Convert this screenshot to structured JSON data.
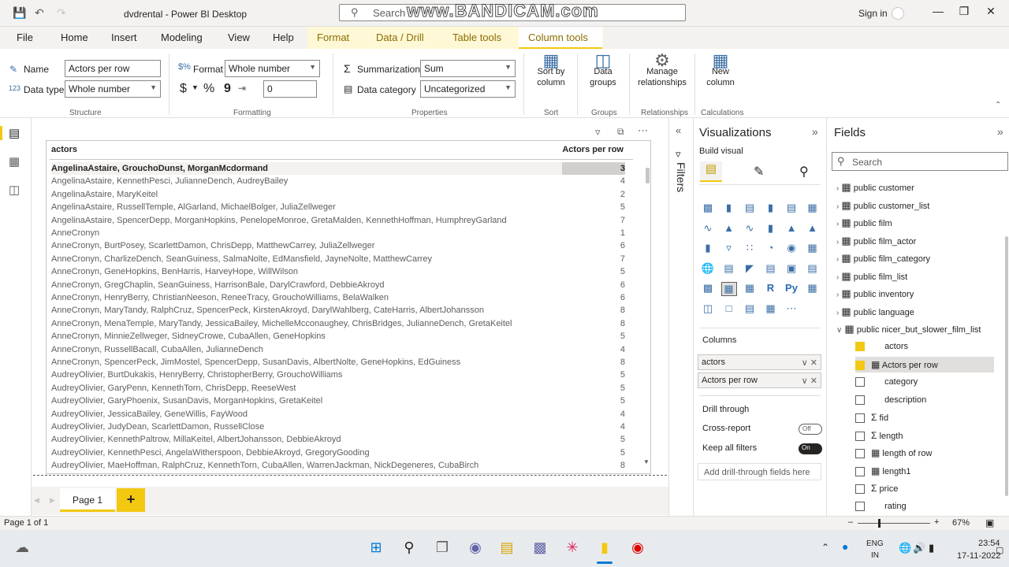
{
  "window": {
    "title": "dvdrental - Power BI Desktop",
    "search_label": "Search",
    "watermark": "www.BANDICAM.com",
    "sign_in": "Sign in"
  },
  "menu": [
    "File",
    "Home",
    "Insert",
    "Modeling",
    "View",
    "Help",
    "Format",
    "Data / Drill",
    "Table tools",
    "Column tools"
  ],
  "ribbon": {
    "name_label": "Name",
    "name_value": "Actors per row",
    "datatype_label": "Data type",
    "datatype_value": "Whole number",
    "structure_group": "Structure",
    "format_label": "Format",
    "format_value": "Whole number",
    "currency": "$",
    "percent": "%",
    "comma": "9",
    "decimals": "0",
    "formatting_group": "Formatting",
    "summarization_label": "Summarization",
    "summarization_value": "Sum",
    "category_label": "Data category",
    "category_value": "Uncategorized",
    "properties_group": "Properties",
    "sort_btn_1": "Sort by",
    "sort_btn_2": "column",
    "sort_group": "Sort",
    "groups_btn_1": "Data",
    "groups_btn_2": "groups",
    "groups_group": "Groups",
    "rel_btn_1": "Manage",
    "rel_btn_2": "relationships",
    "rel_group": "Relationships",
    "newcol_btn_1": "New",
    "newcol_btn_2": "column",
    "calc_group": "Calculations"
  },
  "table": {
    "col1": "actors",
    "col2": "Actors per row",
    "rows": [
      [
        "AngelinaAstaire, GrouchoDunst, MorganMcdormand",
        "3"
      ],
      [
        "AngelinaAstaire, KennethPesci, JulianneDench, AudreyBailey",
        "4"
      ],
      [
        "AngelinaAstaire, MaryKeitel",
        "2"
      ],
      [
        "AngelinaAstaire, RussellTemple, AlGarland, MichaelBolger, JuliaZellweger",
        "5"
      ],
      [
        "AngelinaAstaire, SpencerDepp, MorganHopkins, PenelopeMonroe, GretaMalden, KennethHoffman, HumphreyGarland",
        "7"
      ],
      [
        "AnneCronyn",
        "1"
      ],
      [
        "AnneCronyn, BurtPosey, ScarlettDamon, ChrisDepp, MatthewCarrey, JuliaZellweger",
        "6"
      ],
      [
        "AnneCronyn, CharlizeDench, SeanGuiness, SalmaNolte, EdMansfield, JayneNolte, MatthewCarrey",
        "7"
      ],
      [
        "AnneCronyn, GeneHopkins, BenHarris, HarveyHope, WillWilson",
        "5"
      ],
      [
        "AnneCronyn, GregChaplin, SeanGuiness, HarrisonBale, DarylCrawford, DebbieAkroyd",
        "6"
      ],
      [
        "AnneCronyn, HenryBerry, ChristianNeeson, ReneeTracy, GrouchoWilliams, BelaWalken",
        "6"
      ],
      [
        "AnneCronyn, MaryTandy, RalphCruz, SpencerPeck, KirstenAkroyd, DarylWahlberg, CateHarris, AlbertJohansson",
        "8"
      ],
      [
        "AnneCronyn, MenaTemple, MaryTandy, JessicaBailey, MichelleMcconaughey, ChrisBridges, JulianneDench, GretaKeitel",
        "8"
      ],
      [
        "AnneCronyn, MinnieZellweger, SidneyCrowe, CubaAllen, GeneHopkins",
        "5"
      ],
      [
        "AnneCronyn, RussellBacall, CubaAllen, JulianneDench",
        "4"
      ],
      [
        "AnneCronyn, SpencerPeck, JimMostel, SpencerDepp, SusanDavis, AlbertNolte, GeneHopkins, EdGuiness",
        "8"
      ],
      [
        "AudreyOlivier, BurtDukakis, HenryBerry, ChristopherBerry, GrouchoWilliams",
        "5"
      ],
      [
        "AudreyOlivier, GaryPenn, KennethTorn, ChrisDepp, ReeseWest",
        "5"
      ],
      [
        "AudreyOlivier, GaryPhoenix, SusanDavis, MorganHopkins, GretaKeitel",
        "5"
      ],
      [
        "AudreyOlivier, JessicaBailey, GeneWillis, FayWood",
        "4"
      ],
      [
        "AudreyOlivier, JudyDean, ScarlettDamon, RussellClose",
        "4"
      ],
      [
        "AudreyOlivier, KennethPaltrow, MillaKeitel, AlbertJohansson, DebbieAkroyd",
        "5"
      ],
      [
        "AudreyOlivier, KennethPesci, AngelaWitherspoon, DebbieAkroyd, GregoryGooding",
        "5"
      ],
      [
        "AudreyOlivier, MaeHoffman, RalphCruz, KennethTorn, CubaAllen, WarrenJackman, NickDegeneres, CubaBirch",
        "8"
      ]
    ]
  },
  "filters_label": "Filters",
  "viz": {
    "title": "Visualizations",
    "build": "Build visual",
    "columns_label": "Columns",
    "wells": [
      "actors",
      "Actors per row"
    ],
    "drill": "Drill through",
    "cross": "Cross-report",
    "cross_state": "Off",
    "keep": "Keep all filters",
    "keep_state": "On",
    "add_drill": "Add drill-through fields here"
  },
  "fields": {
    "title": "Fields",
    "search": "Search",
    "tables": [
      "public customer",
      "public customer_list",
      "public film",
      "public film_actor",
      "public film_category",
      "public film_list",
      "public inventory",
      "public language",
      "public nicer_but_slower_film_list"
    ],
    "columns": [
      {
        "name": "actors",
        "checked": true,
        "icon": ""
      },
      {
        "name": "Actors per row",
        "checked": true,
        "icon": "calc-column-icon"
      },
      {
        "name": "category",
        "checked": false,
        "icon": ""
      },
      {
        "name": "description",
        "checked": false,
        "icon": ""
      },
      {
        "name": "fid",
        "checked": false,
        "icon": "sigma-icon"
      },
      {
        "name": "length",
        "checked": false,
        "icon": "sigma-icon"
      },
      {
        "name": "length of row",
        "checked": false,
        "icon": "calc-column-icon"
      },
      {
        "name": "length1",
        "checked": false,
        "icon": "calc-column-icon"
      },
      {
        "name": "price",
        "checked": false,
        "icon": "sigma-icon"
      },
      {
        "name": "rating",
        "checked": false,
        "icon": ""
      }
    ]
  },
  "pages": {
    "tab": "Page 1",
    "add": "+"
  },
  "status": {
    "page": "Page 1 of 1",
    "zoom": "67%"
  },
  "taskbar": {
    "lang1": "ENG",
    "lang2": "IN",
    "time": "23:54",
    "date": "17-11-2022"
  },
  "colors": {
    "accent": "#f2c811",
    "brand": "#8a6d00"
  }
}
